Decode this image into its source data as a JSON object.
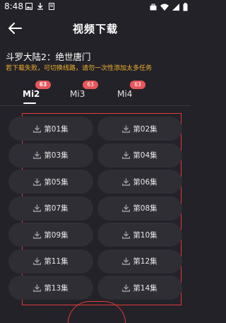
{
  "status_bar": {
    "time": "8:48"
  },
  "header": {
    "title": "视频下载"
  },
  "show": {
    "title": "斗罗大陆2：绝世唐门",
    "notice": "若下载失败，可切换线路，请勿一次性添加太多任务"
  },
  "tabs": [
    {
      "label": "Mi2",
      "badge": "63",
      "active": true
    },
    {
      "label": "Mi3",
      "badge": "63",
      "active": false
    },
    {
      "label": "Mi4",
      "badge": "63",
      "active": false
    }
  ],
  "episodes": [
    "第01集",
    "第02集",
    "第03集",
    "第04集",
    "第05集",
    "第06集",
    "第07集",
    "第08集",
    "第09集",
    "第10集",
    "第11集",
    "第12集",
    "第13集",
    "第14集"
  ],
  "colors": {
    "accent_badge": "#e7575a",
    "notice": "#f0b12f",
    "background": "#232228",
    "highlight": "#e23a3a"
  }
}
